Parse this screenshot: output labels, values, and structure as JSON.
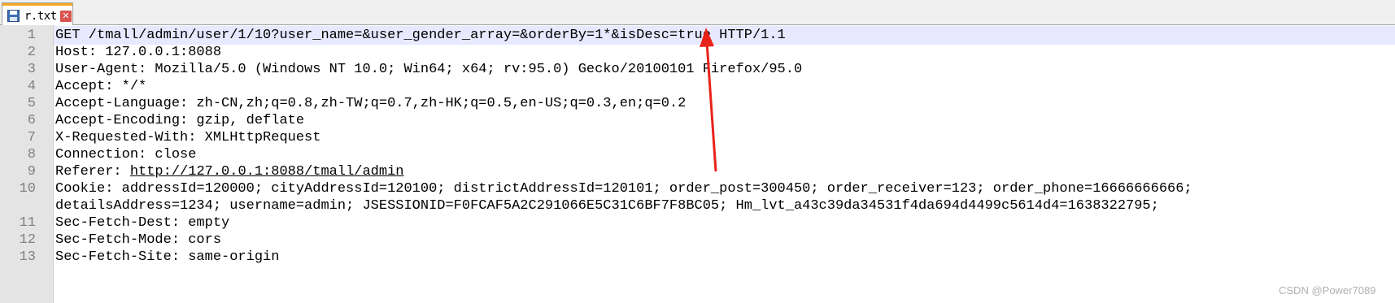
{
  "tab": {
    "filename": "r.txt",
    "close_glyph": "✕"
  },
  "editor": {
    "line_numbers": [
      "1",
      "2",
      "3",
      "4",
      "5",
      "6",
      "7",
      "8",
      "9",
      "10",
      "",
      "11",
      "12",
      "13"
    ],
    "lines": [
      "GET /tmall/admin/user/1/10?user_name=&user_gender_array=&orderBy=1*&isDesc=true HTTP/1.1",
      "Host: 127.0.0.1:8088",
      "User-Agent: Mozilla/5.0 (Windows NT 10.0; Win64; x64; rv:95.0) Gecko/20100101 Firefox/95.0",
      "Accept: */*",
      "Accept-Language: zh-CN,zh;q=0.8,zh-TW;q=0.7,zh-HK;q=0.5,en-US;q=0.3,en;q=0.2",
      "Accept-Encoding: gzip, deflate",
      "X-Requested-With: XMLHttpRequest",
      "Connection: close",
      "Referer: ",
      "Cookie: addressId=120000; cityAddressId=120100; districtAddressId=120101; order_post=300450; order_receiver=123; order_phone=16666666666;",
      "detailsAddress=1234; username=admin; JSESSIONID=F0FCAF5A2C291066E5C31C6BF7F8BC05; Hm_lvt_a43c39da34531f4da694d4499c5614d4=1638322795;",
      "Sec-Fetch-Dest: empty",
      "Sec-Fetch-Mode: cors",
      "Sec-Fetch-Site: same-origin"
    ],
    "referer_link": "http://127.0.0.1:8088/tmall/admin"
  },
  "colors": {
    "tab_accent": "#f5a623",
    "highlight": "#e8e8ff",
    "arrow": "#e8231a"
  },
  "watermark": "CSDN @Power7089"
}
